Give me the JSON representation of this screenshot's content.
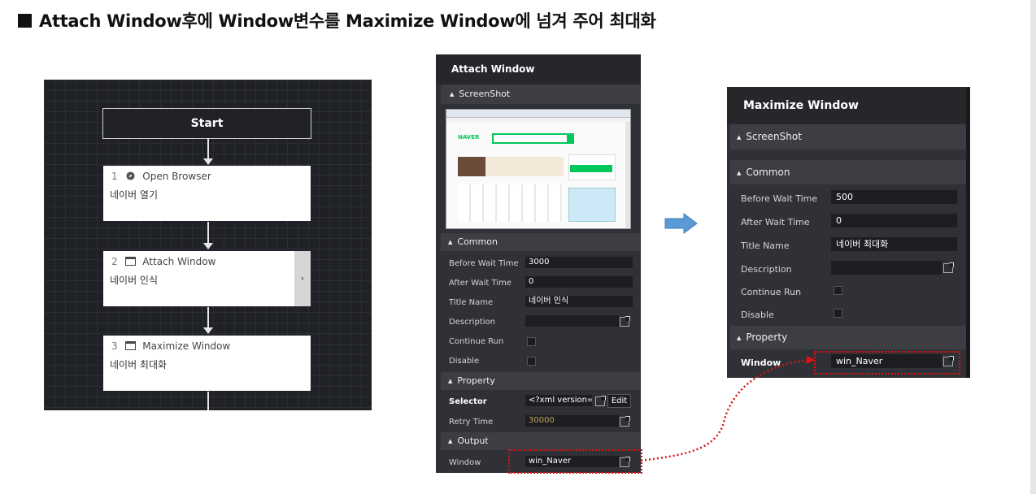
{
  "heading": "Attach Window후에 Window변수를 Maximize Window에 넘겨 주어 최대화",
  "flow": {
    "start_label": "Start",
    "nodes": [
      {
        "num": "1",
        "title": "Open Browser",
        "desc": "네이버 열기",
        "icon": "compass-icon"
      },
      {
        "num": "2",
        "title": "Attach Window",
        "desc": "네이버 인식",
        "icon": "window-icon",
        "expander": "›"
      },
      {
        "num": "3",
        "title": "Maximize Window",
        "desc": "네이버 최대화",
        "icon": "window-icon"
      }
    ]
  },
  "attach_panel": {
    "title": "Attach Window",
    "screenshot_section": "ScreenShot",
    "screenshot": {
      "brand": "NAVER"
    },
    "common_section": "Common",
    "common": {
      "before_wait_label": "Before Wait Time",
      "before_wait_value": "3000",
      "after_wait_label": "After Wait Time",
      "after_wait_value": "0",
      "title_name_label": "Title Name",
      "title_name_value": "네이버 인식",
      "description_label": "Description",
      "description_value": "",
      "continue_run_label": "Continue Run",
      "disable_label": "Disable"
    },
    "property_section": "Property",
    "property": {
      "selector_label": "Selector",
      "selector_value": "<?xml version='1",
      "edit_label": "Edit",
      "retry_label": "Retry Time",
      "retry_value": "30000"
    },
    "output_section": "Output",
    "output": {
      "window_label": "Window",
      "window_value": "win_Naver"
    }
  },
  "maximize_panel": {
    "title": "Maximize Window",
    "screenshot_section": "ScreenShot",
    "common_section": "Common",
    "common": {
      "before_wait_label": "Before Wait Time",
      "before_wait_value": "500",
      "after_wait_label": "After Wait Time",
      "after_wait_value": "0",
      "title_name_label": "Title Name",
      "title_name_value": "네이버 최대화",
      "description_label": "Description",
      "description_value": "",
      "continue_run_label": "Continue Run",
      "disable_label": "Disable"
    },
    "property_section": "Property",
    "property": {
      "window_label": "Window",
      "window_value": "win_Naver"
    }
  },
  "colors": {
    "highlight": "#e01010",
    "arrow": "#5b9bd5",
    "panel_bg": "#2f3136"
  }
}
